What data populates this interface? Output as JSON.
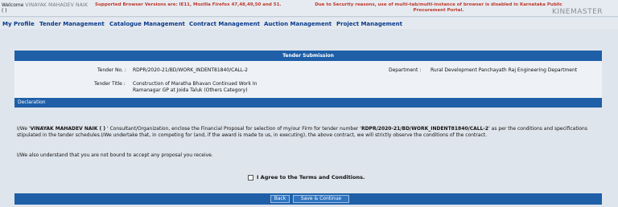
{
  "header": {
    "welcome_prefix": "Welcome",
    "user_name": "VINAYAK MAHADEV NAIK",
    "user_suffix": "( )",
    "browser_note": "Supported Browser Versions are: IE11, Mozilla Firefox 47,48,49,50 and 51.",
    "security_note": "Due to Security reasons, use of multi-tab/multi-instance of browser is disabled in Karnataka Public Procurement Portal.",
    "watermark": "KINEMASTER"
  },
  "menu": {
    "items": [
      {
        "label": "My Profile"
      },
      {
        "label": "Tender Management"
      },
      {
        "label": "Catalogue Management"
      },
      {
        "label": "Contract Management"
      },
      {
        "label": "Auction Management"
      },
      {
        "label": "Project Management"
      }
    ]
  },
  "submission": {
    "title": "Tender Submission",
    "tender_no_label": "Tender No. :",
    "tender_no": "RDPR/2020-21/BD/WORK_INDENT81840/CALL-2",
    "department_label": "Department :",
    "department": "Rural Development Panchayath Raj Engineering Department",
    "tender_title_label": "Tender Title :",
    "tender_title_line1": "Construction of Maratha Bhavan Continued Work In",
    "tender_title_line2": "Ramanagar GP at Joida Taluk (Others Category)"
  },
  "declaration": {
    "title": "Declaration",
    "p1_a": "I/We '",
    "p1_name": "VINAYAK MAHADEV NAIK ( )",
    "p1_b": " ' Consultant/Organization, enclose the Financial Proposal for selection of my/our Firm for tender number '",
    "p1_tender": "RDPR/2020-21/BD/WORK_INDENT81840/CALL-2",
    "p1_c": "' as per the conditions and specifications stipulated in the tender schedules.I/We undertake that, in competing for (and, if the award is made to us, in executing), the above contract, we will strictly observe the conditions of the contract.",
    "p2": "I/We also understand that you are not bound to accept any proposal you receive.",
    "agree_label": "I Agree to the Terms and Conditions."
  },
  "buttons": {
    "back": "Back",
    "save_continue": "Save & Continue"
  }
}
